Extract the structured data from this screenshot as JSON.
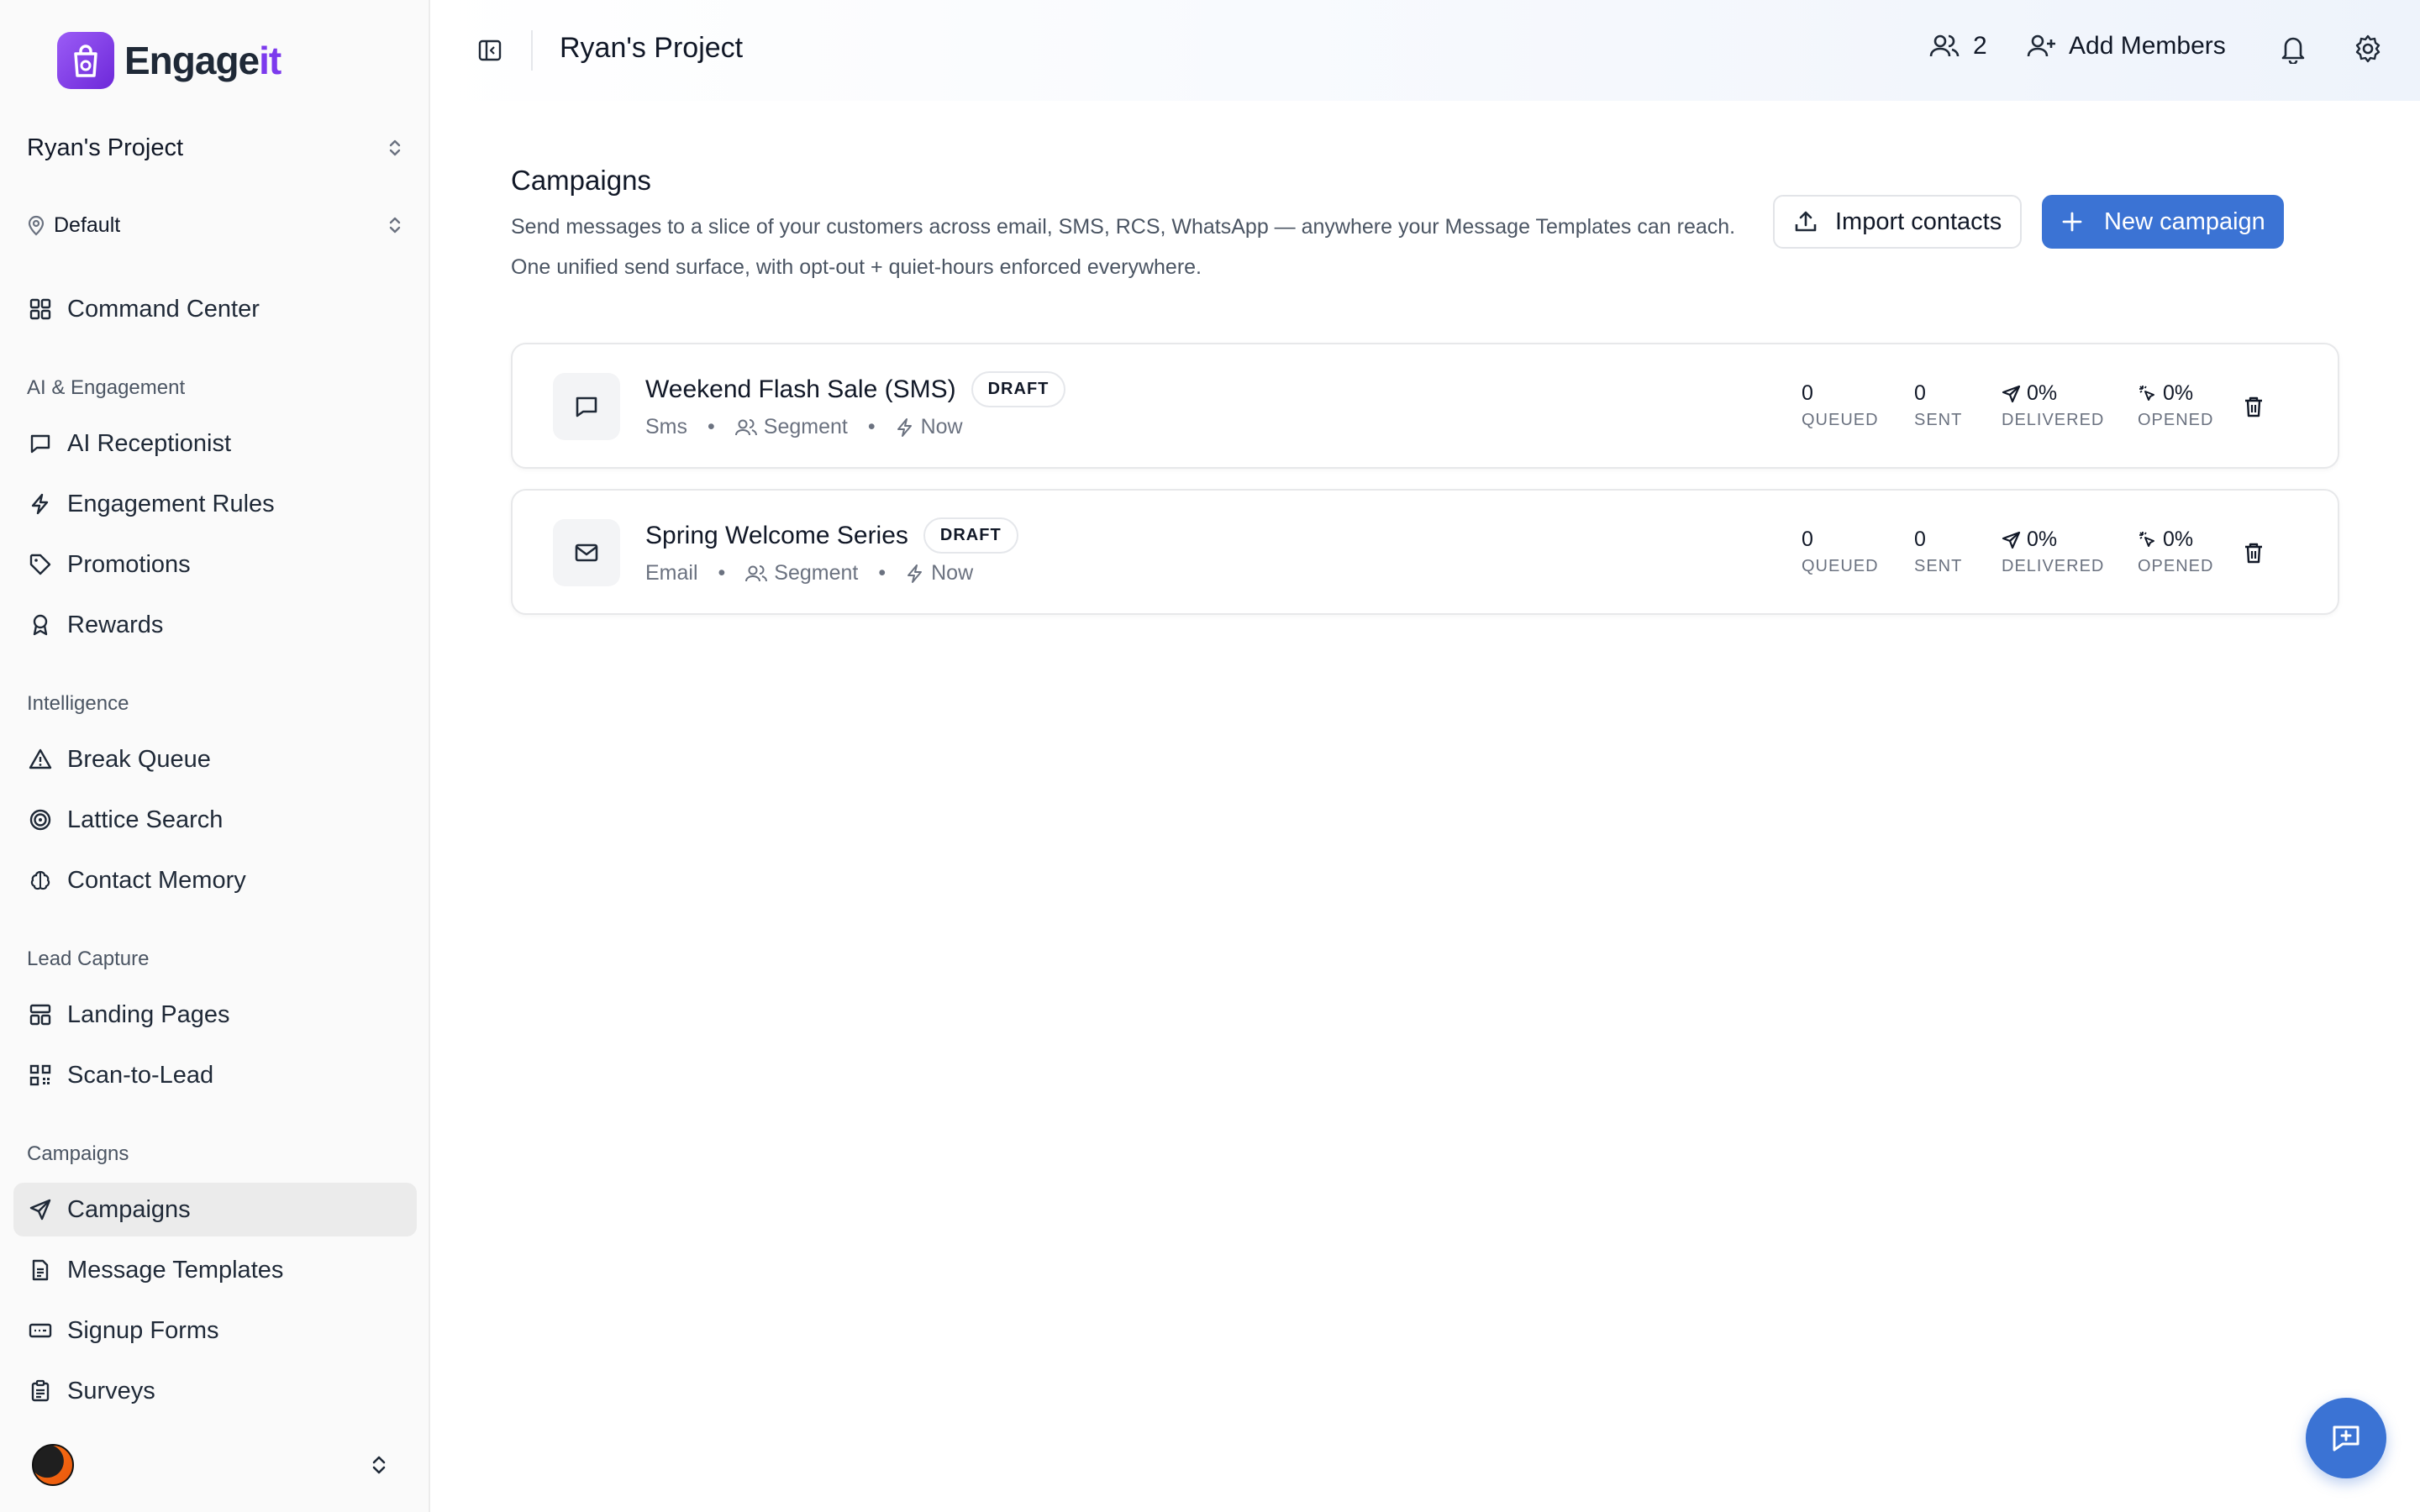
{
  "brand": {
    "name_part1": "Engage",
    "name_part2": "it",
    "accent_color": "#7c3aed"
  },
  "sidebar": {
    "project_name": "Ryan's Project",
    "scope_name": "Default",
    "top_items": [
      {
        "label": "Command Center",
        "icon": "grid-icon"
      }
    ],
    "sections": [
      {
        "title": "AI & Engagement",
        "items": [
          {
            "label": "AI Receptionist",
            "icon": "chat-bubble-icon"
          },
          {
            "label": "Engagement Rules",
            "icon": "lightning-icon"
          },
          {
            "label": "Promotions",
            "icon": "tag-icon"
          },
          {
            "label": "Rewards",
            "icon": "ribbon-icon"
          }
        ]
      },
      {
        "title": "Intelligence",
        "items": [
          {
            "label": "Break Queue",
            "icon": "warning-triangle-icon"
          },
          {
            "label": "Lattice Search",
            "icon": "radar-icon"
          },
          {
            "label": "Contact Memory",
            "icon": "brain-icon"
          }
        ]
      },
      {
        "title": "Lead Capture",
        "items": [
          {
            "label": "Landing Pages",
            "icon": "layout-icon"
          },
          {
            "label": "Scan-to-Lead",
            "icon": "qr-code-icon"
          }
        ]
      },
      {
        "title": "Campaigns",
        "items": [
          {
            "label": "Campaigns",
            "icon": "send-icon",
            "active": true
          },
          {
            "label": "Message Templates",
            "icon": "document-icon"
          },
          {
            "label": "Signup Forms",
            "icon": "form-icon"
          },
          {
            "label": "Surveys",
            "icon": "clipboard-icon"
          }
        ]
      }
    ]
  },
  "header": {
    "title": "Ryan's Project",
    "members_count": "2",
    "add_members_label": "Add Members"
  },
  "main": {
    "title": "Campaigns",
    "description": "Send messages to a slice of your customers across email, SMS, RCS, WhatsApp — anywhere your Message Templates can reach. One unified send surface, with opt-out + quiet-hours enforced everywhere.",
    "import_label": "Import contacts",
    "new_campaign_label": "New campaign",
    "primary_color": "#3b73d4",
    "stat_labels": {
      "queued": "QUEUED",
      "sent": "SENT",
      "delivered": "DELIVERED",
      "opened": "OPENED"
    },
    "campaigns": [
      {
        "name": "Weekend Flash Sale (SMS)",
        "status": "DRAFT",
        "channel": "Sms",
        "channel_icon": "chat-bubble-icon",
        "audience": "Segment",
        "schedule": "Now",
        "queued": "0",
        "sent": "0",
        "delivered": "0%",
        "opened": "0%"
      },
      {
        "name": "Spring Welcome Series",
        "status": "DRAFT",
        "channel": "Email",
        "channel_icon": "mail-icon",
        "audience": "Segment",
        "schedule": "Now",
        "queued": "0",
        "sent": "0",
        "delivered": "0%",
        "opened": "0%"
      }
    ]
  }
}
